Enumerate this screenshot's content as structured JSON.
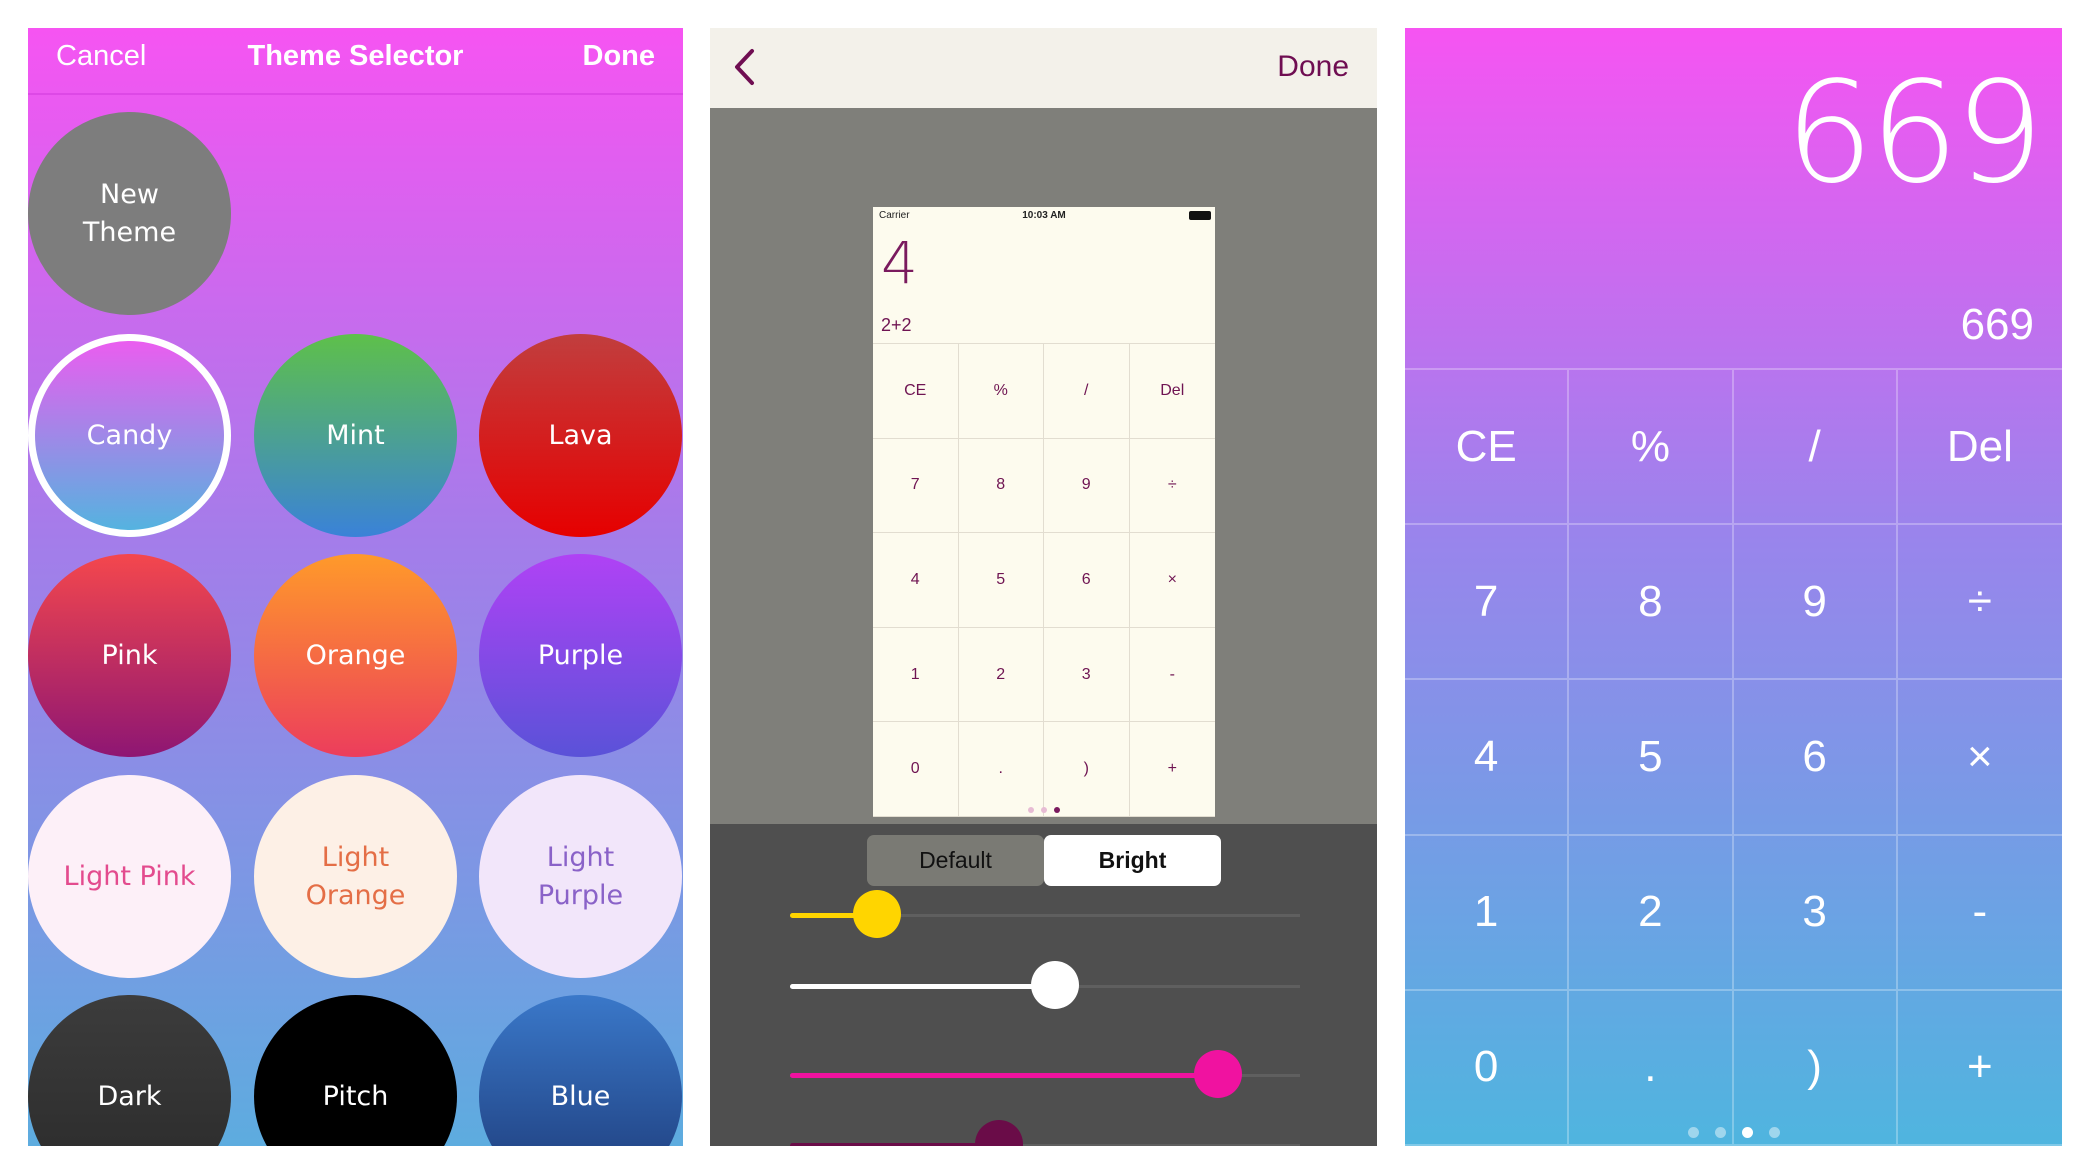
{
  "theme_selector": {
    "cancel_label": "Cancel",
    "title": "Theme Selector",
    "done_label": "Done",
    "new_theme_label": "New\nTheme",
    "selected_theme": "Candy",
    "themes": [
      {
        "label": "Candy",
        "text_color": "#ffffff",
        "gradient": [
          "#f05af0",
          "#4fb6df"
        ]
      },
      {
        "label": "Mint",
        "text_color": "#ffffff",
        "gradient": [
          "#5ec04a",
          "#3a82d8"
        ]
      },
      {
        "label": "Lava",
        "text_color": "#ffffff",
        "gradient": [
          "#c13e3e",
          "#e60000"
        ]
      },
      {
        "label": "Pink",
        "text_color": "#ffffff",
        "gradient": [
          "#f4474d",
          "#8e1673"
        ]
      },
      {
        "label": "Orange",
        "text_color": "#ffffff",
        "gradient": [
          "#ff9a2a",
          "#ec3d5c"
        ]
      },
      {
        "label": "Purple",
        "text_color": "#ffffff",
        "gradient": [
          "#b042f5",
          "#5a52d8"
        ]
      },
      {
        "label": "Light Pink",
        "text_color": "#e34b8e",
        "gradient": [
          "#fdf0f8",
          "#fdf0f8"
        ]
      },
      {
        "label": "Light\nOrange",
        "text_color": "#e46e46",
        "gradient": [
          "#fdf0e6",
          "#fdf0e6"
        ]
      },
      {
        "label": "Light\nPurple",
        "text_color": "#8a62c8",
        "gradient": [
          "#f2e6fa",
          "#f2e6fa"
        ]
      },
      {
        "label": "Dark",
        "text_color": "#ffffff",
        "gradient": [
          "#3c3c3c",
          "#2a2a2a"
        ]
      },
      {
        "label": "Pitch",
        "text_color": "#ffffff",
        "gradient": [
          "#000000",
          "#000000"
        ]
      },
      {
        "label": "Blue",
        "text_color": "#ffffff",
        "gradient": [
          "#3a78c9",
          "#1d3a78"
        ]
      }
    ]
  },
  "theme_editor": {
    "back_icon": "chevron-left-icon",
    "done_label": "Done",
    "preview": {
      "carrier": "Carrier",
      "time": "10:03 AM",
      "result": "4",
      "expression": "2+2",
      "keys": [
        "CE",
        "%",
        "/",
        "Del",
        "7",
        "8",
        "9",
        "÷",
        "4",
        "5",
        "6",
        "×",
        "1",
        "2",
        "3",
        "-",
        "0",
        ".",
        ")",
        "+"
      ],
      "page_count": 3,
      "active_page": 3
    },
    "segments": {
      "default_label": "Default",
      "bright_label": "Bright",
      "selected": "Bright"
    },
    "sliders": [
      {
        "color": "#ffd500",
        "fraction": 0.17
      },
      {
        "color": "#ffffff",
        "fraction": 0.52
      },
      {
        "color": "#f012a0",
        "fraction": 0.84
      },
      {
        "color": "#6a0c48",
        "fraction": 0.41
      }
    ]
  },
  "calculator": {
    "result": "669",
    "expression": "669",
    "keys": [
      "CE",
      "%",
      "/",
      "Del",
      "7",
      "8",
      "9",
      "÷",
      "4",
      "5",
      "6",
      "×",
      "1",
      "2",
      "3",
      "-",
      "0",
      ".",
      ")",
      "+"
    ],
    "page_count": 4,
    "active_page": 3
  }
}
